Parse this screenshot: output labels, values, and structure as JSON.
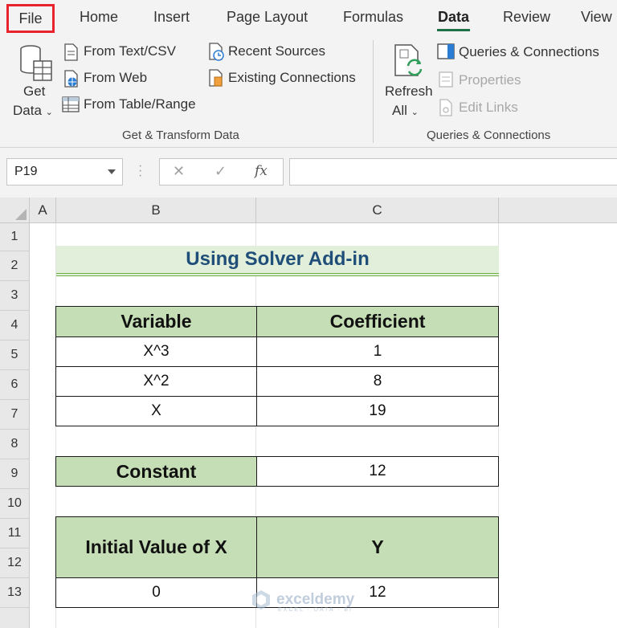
{
  "ribbon": {
    "tabs": [
      "File",
      "Home",
      "Insert",
      "Page Layout",
      "Formulas",
      "Data",
      "Review",
      "View"
    ],
    "active_tab": "Data",
    "get_data": {
      "line1": "Get",
      "line2": "Data"
    },
    "from_text_csv": "From Text/CSV",
    "from_web": "From Web",
    "from_table_range": "From Table/Range",
    "recent_sources": "Recent Sources",
    "existing_connections": "Existing Connections",
    "group_get_transform": "Get & Transform Data",
    "refresh_all": {
      "line1": "Refresh",
      "line2": "All"
    },
    "queries_connections": "Queries & Connections",
    "properties": "Properties",
    "edit_links": "Edit Links",
    "group_queries": "Queries & Connections",
    "highlight_color": "#e8232d",
    "accent_color": "#1e7145"
  },
  "formula_bar": {
    "name_box": "P19",
    "cancel_icon": "✕",
    "enter_icon": "✓",
    "fx_label": "fx",
    "formula": ""
  },
  "columns": [
    "A",
    "B",
    "C"
  ],
  "rows": [
    "1",
    "2",
    "3",
    "4",
    "5",
    "6",
    "7",
    "8",
    "9",
    "10",
    "11",
    "12",
    "13"
  ],
  "sheet": {
    "title": "Using Solver Add-in",
    "coef_table": {
      "headers": [
        "Variable",
        "Coefficient"
      ],
      "rows": [
        [
          "X^3",
          "1"
        ],
        [
          "X^2",
          "8"
        ],
        [
          "X",
          "19"
        ]
      ]
    },
    "constant": {
      "label": "Constant",
      "value": "12"
    },
    "result_table": {
      "headers": [
        "Initial Value of X",
        "Y"
      ],
      "row": [
        "0",
        "12"
      ]
    },
    "header_fill": "#c5deb5",
    "title_fill": "#e2efda",
    "title_color": "#1f4e79"
  },
  "watermark": {
    "name": "exceldemy",
    "tagline": "EXCEL · DATA · BI"
  }
}
